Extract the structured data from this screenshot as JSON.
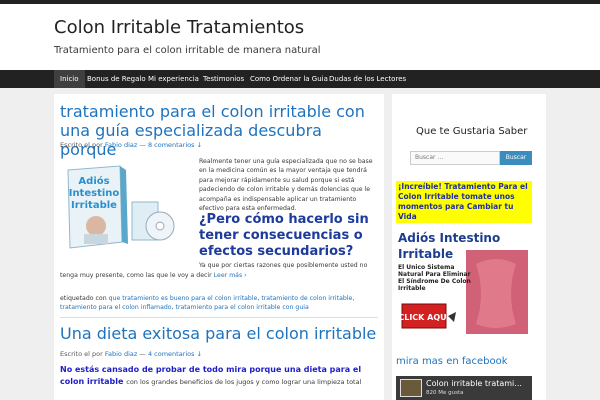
{
  "header": {
    "title": "Colon Irritable Tratamientos",
    "tagline": "Tratamiento para el colon irritable de manera natural"
  },
  "nav": {
    "items": [
      "Inicio",
      "Bonus de Regalo",
      "Mi experiencia",
      "Testimonios",
      "Como Ordenar la Guia",
      "Dudas de los Lectores"
    ]
  },
  "post1": {
    "title": "tratamiento para el colon irritable con una guía especializada descubra porque",
    "meta_prefix": "Escrito el por",
    "author": "Fabio diaz",
    "sep": "—",
    "comments": "8 comentarios ↓",
    "book_text": "Adiós Intestino Irritable",
    "paragraph": "Realmente tener una guía especializada que no se base en la medicina común es la mayor ventaja que tendrá para mejorar rápidamente su salud porque si está padeciendo de colon irritable y demás dolencias que le acompaña es indispensable aplicar un tratamiento efectivo para esta enfermedad.",
    "question": "¿Pero cómo hacerlo sin tener consecuencias o efectos secundarios?",
    "after_q_1": "Ya que por ciertas razones que posiblemente usted no",
    "after_q_2": "tenga muy presente, como las que le voy a decir",
    "read_more": "Leer más ›",
    "tags_prefix": "etiquetado con",
    "tags": [
      "que tratamiento es bueno para el colon irritable",
      "tratamiento de colon irritable",
      "tratamiento para el colon inflamado",
      "tratamiento para el colon irritable con guia"
    ]
  },
  "post2": {
    "title": "Una dieta exitosa para el colon irritable",
    "meta_prefix": "Escrito el por",
    "author": "Fabio diaz",
    "sep": "—",
    "comments": "4 comentarios ↓",
    "lead_bold": "No estás cansado de probar de todo mira porque una dieta para el colon irritable",
    "lead_tail": "con los grandes beneficios de los jugos y como lograr una limpieza total"
  },
  "sidebar": {
    "widget1_title": "Que te Gustaria Saber",
    "search_placeholder": "Buscar …",
    "search_button": "Buscar",
    "promo_text": "¡Increíble! Tratamiento Para el Colon Irritable tomate unos momentos para Cambiar tu Vida",
    "promo_img_title_1": "Adiós Intestino",
    "promo_img_title_2": "Irritable",
    "promo_img_sub": "El Único Sistema Natural Para Eliminar El Síndrome De Colon Irritable",
    "promo_img_cta": "CLICK AQUÍ",
    "widget2_title": "mira mas en facebook",
    "fb_page": "Colon irritable tratami...",
    "fb_likes": "820 Me gusta"
  },
  "colors": {
    "link": "#1e73be",
    "nav_bg": "#222222",
    "promo_bg": "#ffff00",
    "button": "#3b8dbd"
  }
}
